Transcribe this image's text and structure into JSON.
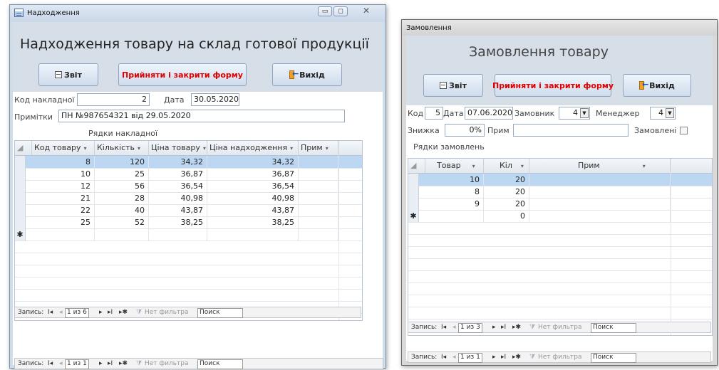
{
  "win1": {
    "title": "Надходження",
    "heading": "Надходження товару на склад готової продукції",
    "buttons": {
      "report": "Звіт",
      "accept": "Прийняти і закрити форму",
      "exit": "Вихід"
    },
    "invoice_code_label": "Код накладної",
    "invoice_code": "2",
    "date_label": "Дата",
    "date": "30.05.2020",
    "notes_label": "Примітки",
    "notes": "ПН №987654321 від 29.05.2020",
    "lines_label": "Рядки накладної",
    "columns": [
      "Код товару",
      "Кількість",
      "Ціна товару",
      "Ціна надходження",
      "Прим"
    ],
    "rows": [
      [
        "8",
        "120",
        "34,32",
        "34,32",
        ""
      ],
      [
        "10",
        "25",
        "36,87",
        "36,87",
        ""
      ],
      [
        "12",
        "56",
        "36,54",
        "36,54",
        ""
      ],
      [
        "21",
        "28",
        "40,98",
        "40,98",
        ""
      ],
      [
        "22",
        "40",
        "43,87",
        "43,87",
        ""
      ],
      [
        "25",
        "52",
        "38,25",
        "38,25",
        ""
      ]
    ],
    "new_row_marker": "✱",
    "sub_nav": {
      "label": "Запись:",
      "position": "1 из 6",
      "filter": "Нет фильтра",
      "search": "Поиск"
    },
    "main_nav": {
      "label": "Запись:",
      "position": "1 из 1",
      "filter": "Нет фильтра",
      "search": "Поиск"
    }
  },
  "win2": {
    "title": "Замовлення",
    "heading": "Замовлення товару",
    "buttons": {
      "report": "Звіт",
      "accept": "Прийняти і закрити форму",
      "exit": "Вихід"
    },
    "code_label": "Код",
    "code": "5",
    "date_label": "Дата",
    "date": "07.06.2020",
    "customer_label": "Замовник",
    "customer": "4",
    "manager_label": "Менеджер",
    "manager": "4",
    "discount_label": "Знижка",
    "discount": "0%",
    "note_label": "Прим",
    "note": "",
    "ordered_label": "Замовлені",
    "ordered": false,
    "lines_label": "Рядки замовлень",
    "columns": [
      "Товар",
      "Кіл",
      "Прим"
    ],
    "rows": [
      [
        "10",
        "20",
        ""
      ],
      [
        "8",
        "20",
        ""
      ],
      [
        "9",
        "20",
        ""
      ]
    ],
    "new_row": [
      "",
      "0",
      ""
    ],
    "new_row_marker": "✱",
    "sub_nav": {
      "label": "Запись:",
      "position": "1 из 3",
      "filter": "Нет фильтра",
      "search": "Поиск"
    },
    "main_nav": {
      "label": "Запись:",
      "position": "1 из 1",
      "filter": "Нет фильтра",
      "search": "Поиск"
    }
  }
}
